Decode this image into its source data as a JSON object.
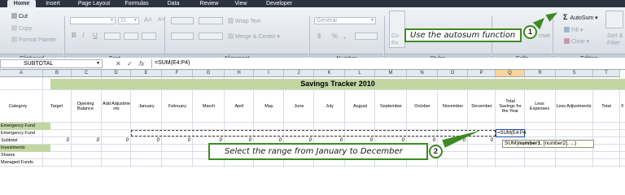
{
  "ribbon": {
    "tabs": [
      "Home",
      "Insert",
      "Page Layout",
      "Formulas",
      "Data",
      "Review",
      "View",
      "Developer"
    ],
    "clipboard": {
      "cut": "Cut",
      "copy": "Copy",
      "format_painter": "Format Painter",
      "group": "Clipboard"
    },
    "font": {
      "size": "11",
      "group": "Font",
      "bold": "B",
      "italic": "I",
      "underline": "U"
    },
    "alignment": {
      "wrap_text": "Wrap Text",
      "merge_center": "Merge & Center",
      "group": "Alignment"
    },
    "number": {
      "format": "General",
      "currency": "$",
      "percent": "%",
      "comma": ",",
      "group": "Number"
    },
    "styles": {
      "group": "Styles",
      "partial_1": "Co",
      "partial_2": "Fo"
    },
    "cells": {
      "group": "Cells",
      "partial": "rmat"
    },
    "editing": {
      "autosum": "AutoSum",
      "fill": "Fill",
      "clear": "Clear",
      "sort": "Sort &",
      "filter": "Filter",
      "group": "Editing"
    }
  },
  "callouts": {
    "c1": {
      "number": "1",
      "text": "Use the autosum function"
    },
    "c2": {
      "number": "2",
      "text": "Select the range from January to December"
    }
  },
  "formula_bar": {
    "name_box": "SUBTOTAL",
    "formula": "=SUM(E4:P4)",
    "cancel": "✕",
    "enter": "✓",
    "fx": "fx"
  },
  "columns": [
    "A",
    "B",
    "C",
    "D",
    "E",
    "F",
    "G",
    "H",
    "I",
    "J",
    "K",
    "L",
    "M",
    "N",
    "O",
    "P",
    "Q",
    "R",
    "S",
    "T"
  ],
  "sheet": {
    "title": "Savings Tracker 2010",
    "headers": {
      "category": "Category",
      "target": "Target",
      "opening": "Opening Balance",
      "add_adj": "Add Adjustments",
      "months": [
        "January",
        "February",
        "March",
        "April",
        "May",
        "June",
        "July",
        "August",
        "September",
        "October",
        "November",
        "December"
      ],
      "total_savings": "Total Savings for the Year",
      "less_exp": "Less Expenses",
      "less_adj": "Less Adjustments",
      "total": "Total",
      "f": "F"
    },
    "rows": [
      "Emergency Fund",
      "Emergency Fund",
      "Subtotal",
      "Investments",
      "Shares",
      "Managed Funds"
    ],
    "zeros": [
      "0",
      "0",
      "0",
      "0",
      "0",
      "0",
      "0",
      "0",
      "0",
      "0",
      "0",
      "0",
      "0",
      "0",
      "0"
    ],
    "active_cell_text": "=SUM(E4:P4",
    "tooltip": {
      "fn": "SUM(",
      "arg1": "number1",
      "rest": ", [number2], ...)"
    }
  },
  "colors": {
    "accent_green": "#3d8a22",
    "title_fill": "#c2d6a2",
    "tab_bar": "#2c3440"
  }
}
